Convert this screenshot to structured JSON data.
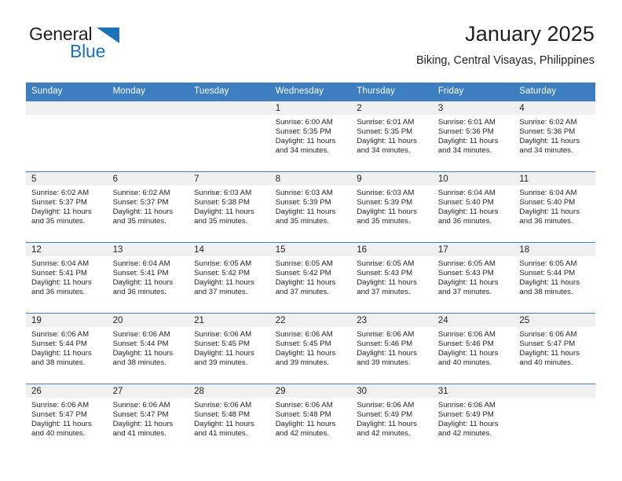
{
  "brand": {
    "name_part1": "General",
    "name_part2": "Blue",
    "triangle_color": "#1b72b8"
  },
  "header": {
    "title": "January 2025",
    "subtitle": "Biking, Central Visayas, Philippines"
  },
  "theme": {
    "header_blue": "#3c7ebf",
    "row_divider": "#4a7ebb",
    "daynum_band": "#f0f0f0"
  },
  "calendar": {
    "weekday_headers": [
      "Sunday",
      "Monday",
      "Tuesday",
      "Wednesday",
      "Thursday",
      "Friday",
      "Saturday"
    ],
    "weeks": [
      [
        {
          "day": "",
          "lines": []
        },
        {
          "day": "",
          "lines": []
        },
        {
          "day": "",
          "lines": []
        },
        {
          "day": "1",
          "lines": [
            "Sunrise: 6:00 AM",
            "Sunset: 5:35 PM",
            "Daylight: 11 hours and 34 minutes."
          ]
        },
        {
          "day": "2",
          "lines": [
            "Sunrise: 6:01 AM",
            "Sunset: 5:35 PM",
            "Daylight: 11 hours and 34 minutes."
          ]
        },
        {
          "day": "3",
          "lines": [
            "Sunrise: 6:01 AM",
            "Sunset: 5:36 PM",
            "Daylight: 11 hours and 34 minutes."
          ]
        },
        {
          "day": "4",
          "lines": [
            "Sunrise: 6:02 AM",
            "Sunset: 5:36 PM",
            "Daylight: 11 hours and 34 minutes."
          ]
        }
      ],
      [
        {
          "day": "5",
          "lines": [
            "Sunrise: 6:02 AM",
            "Sunset: 5:37 PM",
            "Daylight: 11 hours and 35 minutes."
          ]
        },
        {
          "day": "6",
          "lines": [
            "Sunrise: 6:02 AM",
            "Sunset: 5:37 PM",
            "Daylight: 11 hours and 35 minutes."
          ]
        },
        {
          "day": "7",
          "lines": [
            "Sunrise: 6:03 AM",
            "Sunset: 5:38 PM",
            "Daylight: 11 hours and 35 minutes."
          ]
        },
        {
          "day": "8",
          "lines": [
            "Sunrise: 6:03 AM",
            "Sunset: 5:39 PM",
            "Daylight: 11 hours and 35 minutes."
          ]
        },
        {
          "day": "9",
          "lines": [
            "Sunrise: 6:03 AM",
            "Sunset: 5:39 PM",
            "Daylight: 11 hours and 35 minutes."
          ]
        },
        {
          "day": "10",
          "lines": [
            "Sunrise: 6:04 AM",
            "Sunset: 5:40 PM",
            "Daylight: 11 hours and 36 minutes."
          ]
        },
        {
          "day": "11",
          "lines": [
            "Sunrise: 6:04 AM",
            "Sunset: 5:40 PM",
            "Daylight: 11 hours and 36 minutes."
          ]
        }
      ],
      [
        {
          "day": "12",
          "lines": [
            "Sunrise: 6:04 AM",
            "Sunset: 5:41 PM",
            "Daylight: 11 hours and 36 minutes."
          ]
        },
        {
          "day": "13",
          "lines": [
            "Sunrise: 6:04 AM",
            "Sunset: 5:41 PM",
            "Daylight: 11 hours and 36 minutes."
          ]
        },
        {
          "day": "14",
          "lines": [
            "Sunrise: 6:05 AM",
            "Sunset: 5:42 PM",
            "Daylight: 11 hours and 37 minutes."
          ]
        },
        {
          "day": "15",
          "lines": [
            "Sunrise: 6:05 AM",
            "Sunset: 5:42 PM",
            "Daylight: 11 hours and 37 minutes."
          ]
        },
        {
          "day": "16",
          "lines": [
            "Sunrise: 6:05 AM",
            "Sunset: 5:43 PM",
            "Daylight: 11 hours and 37 minutes."
          ]
        },
        {
          "day": "17",
          "lines": [
            "Sunrise: 6:05 AM",
            "Sunset: 5:43 PM",
            "Daylight: 11 hours and 37 minutes."
          ]
        },
        {
          "day": "18",
          "lines": [
            "Sunrise: 6:05 AM",
            "Sunset: 5:44 PM",
            "Daylight: 11 hours and 38 minutes."
          ]
        }
      ],
      [
        {
          "day": "19",
          "lines": [
            "Sunrise: 6:06 AM",
            "Sunset: 5:44 PM",
            "Daylight: 11 hours and 38 minutes."
          ]
        },
        {
          "day": "20",
          "lines": [
            "Sunrise: 6:06 AM",
            "Sunset: 5:44 PM",
            "Daylight: 11 hours and 38 minutes."
          ]
        },
        {
          "day": "21",
          "lines": [
            "Sunrise: 6:06 AM",
            "Sunset: 5:45 PM",
            "Daylight: 11 hours and 39 minutes."
          ]
        },
        {
          "day": "22",
          "lines": [
            "Sunrise: 6:06 AM",
            "Sunset: 5:45 PM",
            "Daylight: 11 hours and 39 minutes."
          ]
        },
        {
          "day": "23",
          "lines": [
            "Sunrise: 6:06 AM",
            "Sunset: 5:46 PM",
            "Daylight: 11 hours and 39 minutes."
          ]
        },
        {
          "day": "24",
          "lines": [
            "Sunrise: 6:06 AM",
            "Sunset: 5:46 PM",
            "Daylight: 11 hours and 40 minutes."
          ]
        },
        {
          "day": "25",
          "lines": [
            "Sunrise: 6:06 AM",
            "Sunset: 5:47 PM",
            "Daylight: 11 hours and 40 minutes."
          ]
        }
      ],
      [
        {
          "day": "26",
          "lines": [
            "Sunrise: 6:06 AM",
            "Sunset: 5:47 PM",
            "Daylight: 11 hours and 40 minutes."
          ]
        },
        {
          "day": "27",
          "lines": [
            "Sunrise: 6:06 AM",
            "Sunset: 5:47 PM",
            "Daylight: 11 hours and 41 minutes."
          ]
        },
        {
          "day": "28",
          "lines": [
            "Sunrise: 6:06 AM",
            "Sunset: 5:48 PM",
            "Daylight: 11 hours and 41 minutes."
          ]
        },
        {
          "day": "29",
          "lines": [
            "Sunrise: 6:06 AM",
            "Sunset: 5:48 PM",
            "Daylight: 11 hours and 42 minutes."
          ]
        },
        {
          "day": "30",
          "lines": [
            "Sunrise: 6:06 AM",
            "Sunset: 5:49 PM",
            "Daylight: 11 hours and 42 minutes."
          ]
        },
        {
          "day": "31",
          "lines": [
            "Sunrise: 6:06 AM",
            "Sunset: 5:49 PM",
            "Daylight: 11 hours and 42 minutes."
          ]
        },
        {
          "day": "",
          "lines": []
        }
      ]
    ]
  }
}
